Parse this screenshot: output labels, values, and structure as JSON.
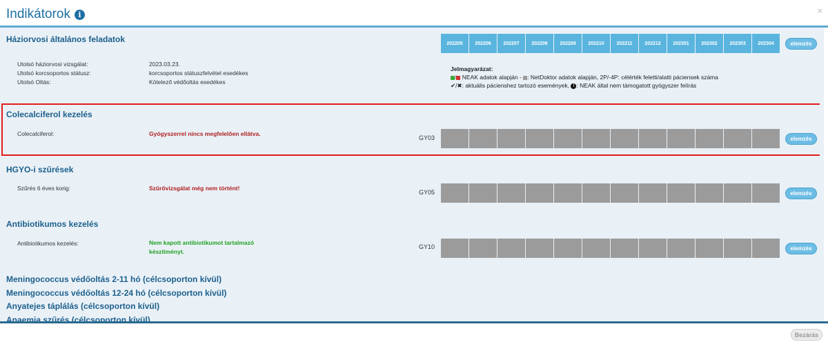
{
  "modal": {
    "title": "Indikátorok",
    "close_x": "×",
    "close_button": "Bezárás"
  },
  "months": [
    "202205",
    "202206",
    "202207",
    "202208",
    "202209",
    "202210",
    "202211",
    "202212",
    "202301",
    "202302",
    "202303",
    "202304"
  ],
  "elemzes_label": "elemzés",
  "general": {
    "title": "Háziorvosi általános feladatok",
    "rows": [
      {
        "label": "Utolsó háziorvosi vizsgálat:",
        "value": "2023.03.23."
      },
      {
        "label": "Utolsó korcsoportos státusz:",
        "value": "korcsoportos státuszfelvétel esedékes"
      },
      {
        "label": "Utolsó Oltás:",
        "value": "Kötelező védőoltás esedékes"
      }
    ]
  },
  "legend": {
    "title": "Jelmagyarázat:",
    "line1": "NEAK adatok alapján -",
    "line1b": ": NetDoktor adatok alapján, 2P/-4P: célérték feletti/alatti páciensek száma",
    "line2": "✔/✖: aktuális pácienshez tartozó események,",
    "line2b": ": NEAK által nem támogatott gyógyszer felírás",
    "colors": {
      "green": "#3aa83a",
      "red": "#d03030",
      "gray": "#9b9b9b"
    }
  },
  "colecalciferol": {
    "title": "Colecalciferol kezelés",
    "label": "Colecalciferol:",
    "status": "Gyógyszerrel nincs megfelelően ellátva.",
    "code": "GY03"
  },
  "hgyo": {
    "title": "HGYO-i szűrések",
    "label": "Szűrés 6 éves korig:",
    "status": "Szűrővizsgálat még nem történt!",
    "code": "GY05"
  },
  "antibiotic": {
    "title": "Antibiotikumos kezelés",
    "label": "Antibiotikumos kezelés:",
    "status_line1": "Nem kapott antibiotikumot tartalmazó",
    "status_line2": "készítményt.",
    "code": "GY10"
  },
  "more_sections": [
    "Meningococcus védőoltás 2-11 hó (célcsoporton kívül)",
    "Meningococcus védőoltás 12-24 hó (célcsoporton kívül)",
    "Anyatejes táplálás (célcsoporton kívül)",
    "Anaemia szűrés (célcsoporton kívül)"
  ]
}
